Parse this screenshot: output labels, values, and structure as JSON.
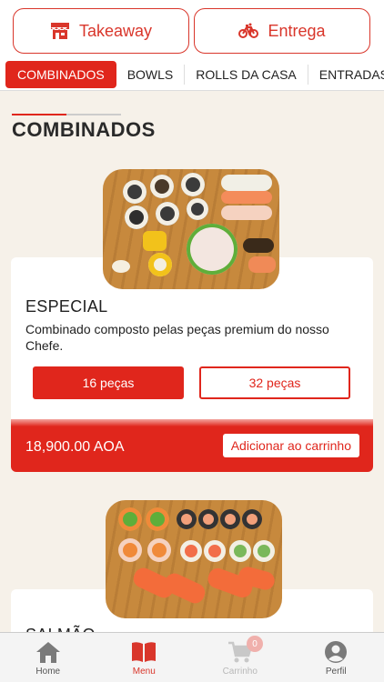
{
  "modes": {
    "takeaway": "Takeaway",
    "delivery": "Entrega"
  },
  "tabs": [
    "COMBINADOS",
    "BOWLS",
    "ROLLS DA CASA",
    "ENTRADAS"
  ],
  "section": {
    "title": "COMBINADOS"
  },
  "products": [
    {
      "name": "ESPECIAL",
      "description": "Combinado composto pelas peças premium do nosso Chefe.",
      "options": [
        "16 peças",
        "32 peças"
      ],
      "selected_option": "16 peças",
      "price": "18,900.00 AOA",
      "add_label": "Adicionar ao carrinho"
    },
    {
      "name": "SALMÃO"
    }
  ],
  "bottom_nav": {
    "home": "Home",
    "menu": "Menu",
    "cart": "Carrinho",
    "cart_count": "0",
    "profile": "Perfil"
  },
  "colors": {
    "accent": "#e0261c",
    "background": "#f6f1e9"
  }
}
